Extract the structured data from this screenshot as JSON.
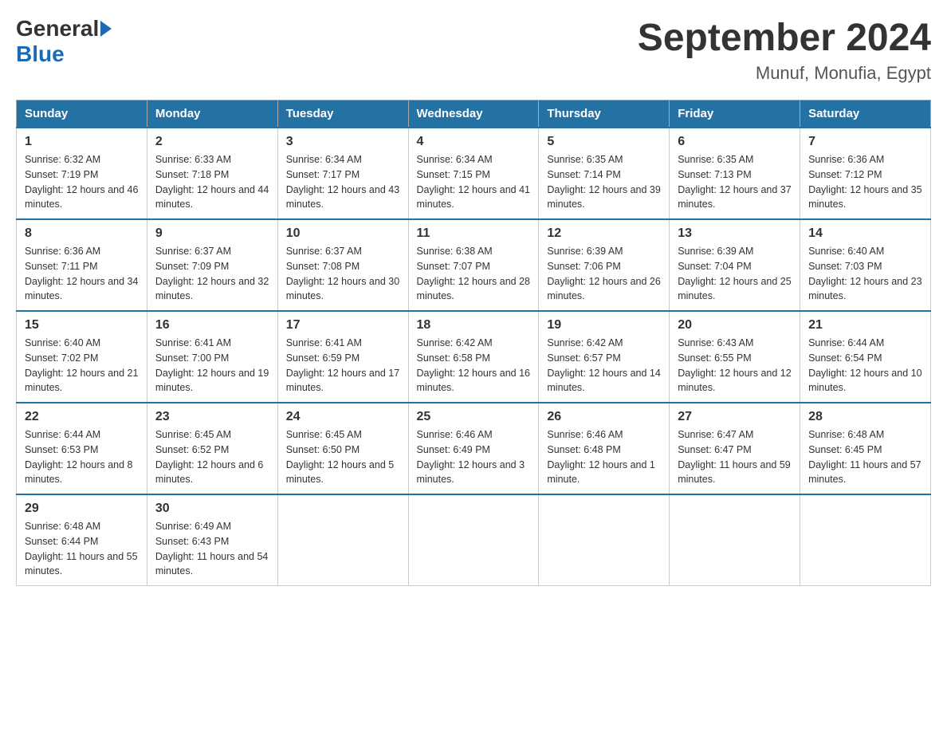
{
  "logo": {
    "general": "General",
    "blue": "Blue"
  },
  "title": "September 2024",
  "subtitle": "Munuf, Monufia, Egypt",
  "weekdays": [
    "Sunday",
    "Monday",
    "Tuesday",
    "Wednesday",
    "Thursday",
    "Friday",
    "Saturday"
  ],
  "weeks": [
    [
      {
        "day": "1",
        "sunrise": "6:32 AM",
        "sunset": "7:19 PM",
        "daylight": "12 hours and 46 minutes."
      },
      {
        "day": "2",
        "sunrise": "6:33 AM",
        "sunset": "7:18 PM",
        "daylight": "12 hours and 44 minutes."
      },
      {
        "day": "3",
        "sunrise": "6:34 AM",
        "sunset": "7:17 PM",
        "daylight": "12 hours and 43 minutes."
      },
      {
        "day": "4",
        "sunrise": "6:34 AM",
        "sunset": "7:15 PM",
        "daylight": "12 hours and 41 minutes."
      },
      {
        "day": "5",
        "sunrise": "6:35 AM",
        "sunset": "7:14 PM",
        "daylight": "12 hours and 39 minutes."
      },
      {
        "day": "6",
        "sunrise": "6:35 AM",
        "sunset": "7:13 PM",
        "daylight": "12 hours and 37 minutes."
      },
      {
        "day": "7",
        "sunrise": "6:36 AM",
        "sunset": "7:12 PM",
        "daylight": "12 hours and 35 minutes."
      }
    ],
    [
      {
        "day": "8",
        "sunrise": "6:36 AM",
        "sunset": "7:11 PM",
        "daylight": "12 hours and 34 minutes."
      },
      {
        "day": "9",
        "sunrise": "6:37 AM",
        "sunset": "7:09 PM",
        "daylight": "12 hours and 32 minutes."
      },
      {
        "day": "10",
        "sunrise": "6:37 AM",
        "sunset": "7:08 PM",
        "daylight": "12 hours and 30 minutes."
      },
      {
        "day": "11",
        "sunrise": "6:38 AM",
        "sunset": "7:07 PM",
        "daylight": "12 hours and 28 minutes."
      },
      {
        "day": "12",
        "sunrise": "6:39 AM",
        "sunset": "7:06 PM",
        "daylight": "12 hours and 26 minutes."
      },
      {
        "day": "13",
        "sunrise": "6:39 AM",
        "sunset": "7:04 PM",
        "daylight": "12 hours and 25 minutes."
      },
      {
        "day": "14",
        "sunrise": "6:40 AM",
        "sunset": "7:03 PM",
        "daylight": "12 hours and 23 minutes."
      }
    ],
    [
      {
        "day": "15",
        "sunrise": "6:40 AM",
        "sunset": "7:02 PM",
        "daylight": "12 hours and 21 minutes."
      },
      {
        "day": "16",
        "sunrise": "6:41 AM",
        "sunset": "7:00 PM",
        "daylight": "12 hours and 19 minutes."
      },
      {
        "day": "17",
        "sunrise": "6:41 AM",
        "sunset": "6:59 PM",
        "daylight": "12 hours and 17 minutes."
      },
      {
        "day": "18",
        "sunrise": "6:42 AM",
        "sunset": "6:58 PM",
        "daylight": "12 hours and 16 minutes."
      },
      {
        "day": "19",
        "sunrise": "6:42 AM",
        "sunset": "6:57 PM",
        "daylight": "12 hours and 14 minutes."
      },
      {
        "day": "20",
        "sunrise": "6:43 AM",
        "sunset": "6:55 PM",
        "daylight": "12 hours and 12 minutes."
      },
      {
        "day": "21",
        "sunrise": "6:44 AM",
        "sunset": "6:54 PM",
        "daylight": "12 hours and 10 minutes."
      }
    ],
    [
      {
        "day": "22",
        "sunrise": "6:44 AM",
        "sunset": "6:53 PM",
        "daylight": "12 hours and 8 minutes."
      },
      {
        "day": "23",
        "sunrise": "6:45 AM",
        "sunset": "6:52 PM",
        "daylight": "12 hours and 6 minutes."
      },
      {
        "day": "24",
        "sunrise": "6:45 AM",
        "sunset": "6:50 PM",
        "daylight": "12 hours and 5 minutes."
      },
      {
        "day": "25",
        "sunrise": "6:46 AM",
        "sunset": "6:49 PM",
        "daylight": "12 hours and 3 minutes."
      },
      {
        "day": "26",
        "sunrise": "6:46 AM",
        "sunset": "6:48 PM",
        "daylight": "12 hours and 1 minute."
      },
      {
        "day": "27",
        "sunrise": "6:47 AM",
        "sunset": "6:47 PM",
        "daylight": "11 hours and 59 minutes."
      },
      {
        "day": "28",
        "sunrise": "6:48 AM",
        "sunset": "6:45 PM",
        "daylight": "11 hours and 57 minutes."
      }
    ],
    [
      {
        "day": "29",
        "sunrise": "6:48 AM",
        "sunset": "6:44 PM",
        "daylight": "11 hours and 55 minutes."
      },
      {
        "day": "30",
        "sunrise": "6:49 AM",
        "sunset": "6:43 PM",
        "daylight": "11 hours and 54 minutes."
      },
      null,
      null,
      null,
      null,
      null
    ]
  ]
}
